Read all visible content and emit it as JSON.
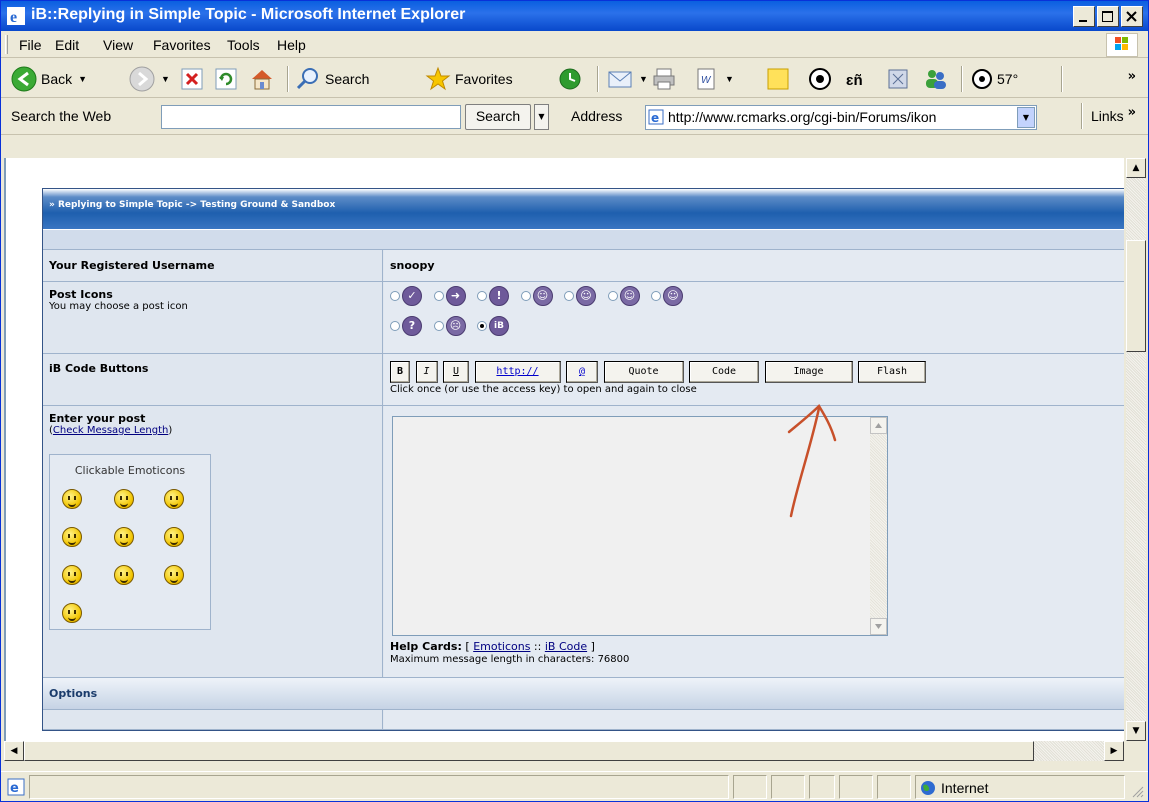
{
  "window": {
    "title": "iB::Replying in Simple Topic - Microsoft Internet Explorer"
  },
  "menu": {
    "items": [
      {
        "label": "File"
      },
      {
        "label": "Edit"
      },
      {
        "label": "View"
      },
      {
        "label": "Favorites"
      },
      {
        "label": "Tools"
      },
      {
        "label": "Help"
      }
    ]
  },
  "toolbar": {
    "back_label": "Back",
    "search_label": "Search",
    "favorites_label": "Favorites",
    "weather_label": "57°"
  },
  "addressbar": {
    "search_web_label": "Search the Web",
    "search_button_label": "Search",
    "address_label": "Address",
    "url": "http://www.rcmarks.org/cgi-bin/Forums/ikon",
    "links_label": "Links"
  },
  "forum": {
    "heading": "» Replying to Simple Topic -> Testing Ground & Sandbox",
    "username_label": "Your Registered Username",
    "username_value": "snoopy",
    "post_icons_label": "Post Icons",
    "post_icons_desc": "You may choose a post icon",
    "post_icons_row2": [
      "?",
      "",
      "iB"
    ],
    "code_buttons_label": "iB Code Buttons",
    "code_buttons": [
      "B",
      "I",
      "U",
      "http://",
      "@",
      "Quote",
      "Code",
      "Image",
      "Flash"
    ],
    "code_buttons_hint": "Click once (or use the access key) to open and again to close",
    "enter_post_label": "Enter your post",
    "check_length_label": "Check Message Length",
    "emoticons_caption": "Clickable Emoticons",
    "help_cards_label": "Help Cards:",
    "help_emoticons_link": "Emoticons",
    "help_ibcode_link": "iB Code",
    "max_length_text": "Maximum message length in characters: 76800",
    "options_label": "Options"
  },
  "statusbar": {
    "zone": "Internet"
  },
  "colors": {
    "title_bar": "#0A5FE0",
    "forum_header": "#1E5FAE",
    "annotation_arrow": "#C8502A"
  }
}
